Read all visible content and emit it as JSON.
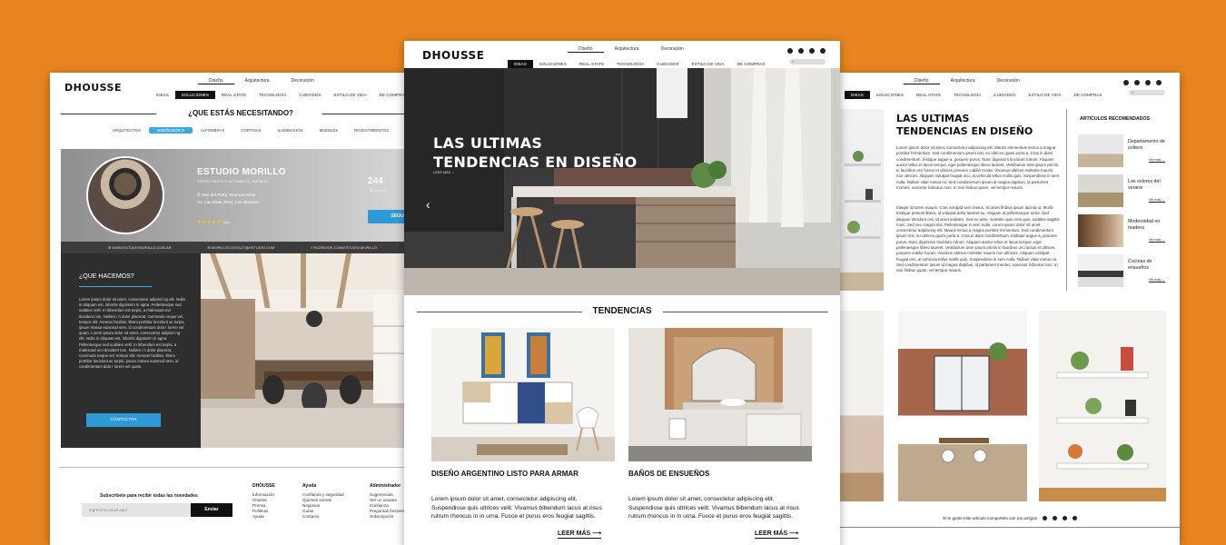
{
  "colors": {
    "background": "#e9851f",
    "accent": "#2d9ad6",
    "dark": "#111111"
  },
  "left": {
    "logo": "DHOUSSE",
    "topnav": [
      "Diseño",
      "Arquitectura",
      "Decoración"
    ],
    "mainnav": [
      "IDEAS",
      "SOLUCIONES",
      "REAL STATE",
      "TECNOLOGÍA",
      "CUIDADOS",
      "ESTILO DE VIDA",
      "DE COMPRAS"
    ],
    "question": "¿QUE ESTÁS NECESITANDO?",
    "categories": [
      "ARQUITECTOS",
      "DISEÑADOR D",
      "ALFOMBRAS",
      "CORTINAS",
      "ILUMINACIÓN",
      "MUEBLES",
      "REVESTIMIENTOS",
      "JARDÍN"
    ],
    "studio": {
      "name": "ESTUDIO MORILLO",
      "tags": "DISEÑO GRÁFICO, ALFOMBRAS, MUEBLES",
      "city": "Mar del Plata, Buenos Aires",
      "address": "Av. Las Elias 2934, Los Blancas",
      "stars": "★★★★★",
      "reviews": "(12)",
      "count": "244",
      "count_label": "SEGUIDOS",
      "follow": "SEGUIR"
    },
    "contacts": [
      "WWW.ESTUDIOMORILLO.COM.AR",
      "MORILLOCONTACT@ESTUDIO.COM",
      "FACEBOOK.COM/ESTUDIO.MORILLO"
    ],
    "what": {
      "title": "¿QUE HACEMOS?",
      "text": "Lorem ipsum dolor sit amet, consectetur adipisci ng elit. Nulla in aliquam est, lobortis dignissim in agna. Pellentesque sed sodales velit. In bibendum est turpis, a malesuad orci tincidunt non. Nullam i n dolor placerat, commodo neque vel, tempor elit. Aenean facilisis, libero porttitor tincidunt ac turpis, ipsum massa euismod sem, id condimentum dolo r lorem vel quam. Lorem ipsum dolor sit amet, consectetur adipisci ng elit. Nulla in aliquam est, lobortis dignissim in agna. Pellentesque sed sodales velit. In bibendum est turpis, a malesuad orci tincidunt non. Nullam i n dolor placerat, commodo neque vel, tempor elit. Aenean facilisis, libero porttitor tincidunt ac turpis, ipsum massa euismod sem, id condimentum dolo r lorem vel quam.",
      "button": "CONTACTAR"
    },
    "footer": {
      "subscribe": "Subscribete para recibir todas las novedades",
      "email_placeholder": "Ingresá tu email aquí",
      "send": "Enviar",
      "cols": [
        {
          "title": "DHOUSSE",
          "items": [
            "Información",
            "Charlas",
            "Prensa",
            "Políticas",
            "Ayuda"
          ]
        },
        {
          "title": "Ayuda",
          "items": [
            "Confianza y seguridad",
            "Quienes somos",
            "Negocios",
            "Guías",
            "Contacto"
          ]
        },
        {
          "title": "Administrador",
          "items": [
            "Sugerencias",
            "Ser un usuario",
            "Confianza",
            "Preguntas frecuentes",
            "Subscripción"
          ]
        }
      ]
    }
  },
  "center": {
    "logo": "DHOUSSE",
    "topnav": [
      "Diseño",
      "Arquitectura",
      "Decoración"
    ],
    "mainnav": [
      "IDEAS",
      "SOLUCIONES",
      "REAL STATE",
      "TECNOLOGÍA",
      "CUIDADOS",
      "ESTILO DE VIDA",
      "DE COMPRAS"
    ],
    "hero_title_1": "LAS ULTIMAS",
    "hero_title_2": "TENDENCIAS EN DISEÑO",
    "hero_more": "LEER MÁS →",
    "section": "TENDENCIAS",
    "cards": [
      {
        "title": "DISEÑO ARGENTINO LISTO PARA ARMAR",
        "text": "Lorem ipsum dolor sit amet, consectetur adipiscing elit. Suspendisse quis ultrices velit. Vivamus bibendum lacus at risus rutrum rhoncus in in urna. Fusce et purus eros feugiat sagittis.",
        "more": "LEER MÁS"
      },
      {
        "title": "BAÑOS DE ENSUEÑOS",
        "text": "Lorem ipsum dolor sit amet, consectetur adipiscing elit. Suspendisse quis ultrices velit. Vivamus bibendum lacus at risus rutrum rhoncus in in urna. Fusce et purus eros feugiat sagittis.",
        "more": "LEER MÁS"
      }
    ]
  },
  "right": {
    "topnav": [
      "Diseño",
      "Arquitectura",
      "Decoración"
    ],
    "mainnav": [
      "IDEAS",
      "SOLUCIONES",
      "REAL STATE",
      "TECNOLOGÍA",
      "CUIDADOS",
      "ESTILO DE VIDA",
      "DE COMPRAS"
    ],
    "title_1": "LAS ULTIMAS",
    "title_2": "TENDENCIAS EN DISEÑO",
    "para1": "Lorem ipsum dolor sit amet, consectetur adipiscing elit. Mauris elementum lectus a magna porttitor fermentum. Sed condimentum ipsum nisl, eu ultrices quam porta a. Cras in diam condimentum, tristique augue a, posuere purus. Nunc dignissim tincidunt rutrum. Aliquam auctor tellus et lacus tempor, eget pellentesque libero laoreet. Vestibulum ante ipsum primis in faucibus orci luctus et ultrices posuere cubilia Curae; Vivamus ultrices molestie mauris non ultricies. Aliquam volutpat feugiat orci, at vehicula tellus mollis quis. Suspendisse in sem nulla. Nullam vitae metus mi. Sed condimentum ipsum id magna dapibus, id parturient montes, nascetur ridiculus mus. In non finibus quam, vel tempor mauris.",
    "para2": "Integer id lorem mauris. Cras volutpat sem metus, sit amet finibus ipsum lacinia ut. Morbi tristique pretium libero, id volutpat dolor laoreet eu. Aliquam at pellentesque tortor. Sed aliquam tincidunt orci sit amet sodales. Sed ex ante, molestie quis eros quis, sodales sagittis nunc. Sed nec magna nisi. Pellentesque in sem nulla. Lorem ipsum dolor sit amet, consectetur adipiscing elit. Mauris lectus a magna porttitor fermentum. Sed condimentum ipsum nisl, eu ultrices quam porta a. Cras in diam condimentum, tristique augue a, posuere purus. Nunc dignissim tincidunt rutrum. Aliquam auctor tellus et lacus tempor, eget pellentesque libero laoreet. Vestibulum ante ipsum primis in faucibus orci luctus et ultrices posuere cubilia Curae; Vivamus ultrices molestie mauris non ultricies. Aliquam volutpat feugiat orci, at vehicula tellus mollis quis. Suspendisse in sem nulla. Nullam vitae metus mi. Sed condimentum ipsum id magna dapibus, id parturient montes, nascetur ridiculus mus. In non finibus quam, vel tempor mauris.",
    "recommended": "ARTICULOS RECOMENDADOS",
    "rec_items": [
      {
        "title": "Departamento de soltero",
        "more": "Ver más →"
      },
      {
        "title": "Los colores del verano",
        "more": "Ver más →"
      },
      {
        "title": "Modernidad en madera",
        "more": "Ver más →"
      },
      {
        "title": "Cocinas de ensueños",
        "more": "Ver más →"
      }
    ],
    "share": "Si te gusto este articulo compartelo con tus amigos"
  }
}
